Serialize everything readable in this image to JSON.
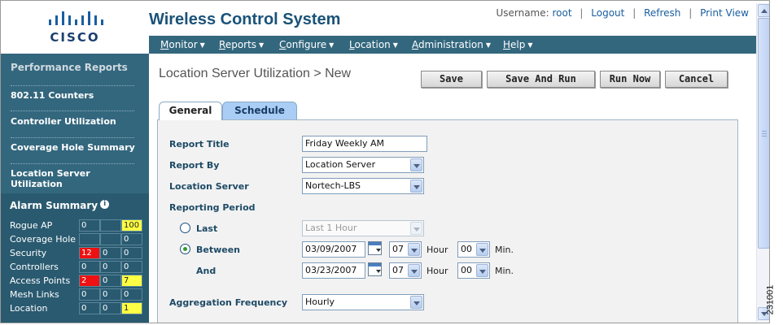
{
  "brand": {
    "logo_text": "CISCO"
  },
  "app_title": "Wireless Control System",
  "user_bar": {
    "username_label": "Username:",
    "username": "root",
    "logout": "Logout",
    "refresh": "Refresh",
    "print_view": "Print View",
    "separator": "|"
  },
  "menu": [
    {
      "key": "M",
      "rest": "onitor"
    },
    {
      "key": "R",
      "rest": "eports"
    },
    {
      "key": "C",
      "rest": "onfigure"
    },
    {
      "key": "L",
      "rest": "ocation"
    },
    {
      "key": "A",
      "rest": "dministration"
    },
    {
      "key": "H",
      "rest": "elp"
    }
  ],
  "sidebar": {
    "heading": "Performance Reports",
    "items": [
      "802.11 Counters",
      "Controller Utilization",
      "Coverage Hole Summary",
      "Location Server Utilization"
    ]
  },
  "alarm_summary": {
    "title": "Alarm Summary",
    "info_icon": "i",
    "rows": [
      {
        "label": "Rogue AP",
        "c1": "0",
        "c2": "",
        "c3": "100",
        "c1_color": "",
        "c3_color": "yellow"
      },
      {
        "label": "Coverage Hole",
        "c1": "",
        "c2": "",
        "c3": "0",
        "c1_color": "",
        "c3_color": ""
      },
      {
        "label": "Security",
        "c1": "12",
        "c2": "0",
        "c3": "0",
        "c1_color": "red",
        "c3_color": ""
      },
      {
        "label": "Controllers",
        "c1": "0",
        "c2": "0",
        "c3": "0",
        "c1_color": "",
        "c3_color": ""
      },
      {
        "label": "Access Points",
        "c1": "2",
        "c2": "0",
        "c3": "7",
        "c1_color": "red",
        "c3_color": "yellow"
      },
      {
        "label": "Mesh Links",
        "c1": "0",
        "c2": "0",
        "c3": "0",
        "c1_color": "",
        "c3_color": ""
      },
      {
        "label": "Location",
        "c1": "0",
        "c2": "0",
        "c3": "1",
        "c1_color": "",
        "c3_color": "yellow"
      }
    ]
  },
  "page_title": "Location Server Utilization > New",
  "buttons": {
    "save": "Save",
    "save_and_run": "Save And Run",
    "run_now": "Run Now",
    "cancel": "Cancel"
  },
  "tabs": {
    "general": "General",
    "schedule": "Schedule"
  },
  "form": {
    "report_title_label": "Report Title",
    "report_title_value": "Friday Weekly AM",
    "report_by_label": "Report By",
    "report_by_value": "Location Server",
    "location_server_label": "Location Server",
    "location_server_value": "Nortech-LBS",
    "reporting_period_label": "Reporting Period",
    "last_label": "Last",
    "last_value": "Last 1 Hour",
    "between_label": "Between",
    "between_date": "03/09/2007",
    "between_hour": "07",
    "between_min": "00",
    "and_label": "And",
    "and_date": "03/23/2007",
    "and_hour": "07",
    "and_min": "00",
    "hour_unit": "Hour",
    "min_unit": "Min.",
    "aggregation_label": "Aggregation Frequency",
    "aggregation_value": "Hourly"
  },
  "figure_id": "231001",
  "colors": {
    "nav_bg": "#33677e",
    "title_blue": "#1a5278",
    "tab_schedule": "#a9cdf5"
  }
}
